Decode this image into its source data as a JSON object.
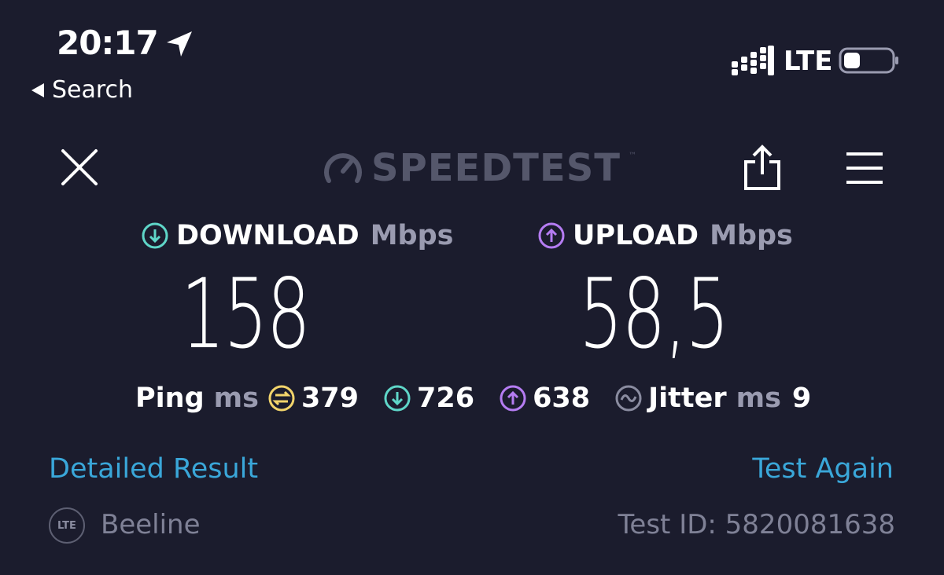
{
  "status_bar": {
    "time": "20:17",
    "back_label": "Search",
    "network": "LTE"
  },
  "header": {
    "logo_text": "SPEEDTEST",
    "logo_mark": "™"
  },
  "results": {
    "download": {
      "label": "DOWNLOAD",
      "unit": "Mbps",
      "value": "158",
      "color": "#5fd6c8"
    },
    "upload": {
      "label": "UPLOAD",
      "unit": "Mbps",
      "value": "58,5",
      "color": "#b57cf2"
    }
  },
  "ping": {
    "label": "Ping",
    "unit": "ms",
    "idle_value": "379",
    "download_value": "726",
    "upload_value": "638",
    "jitter_label": "Jitter",
    "jitter_unit": "ms",
    "jitter_value": "9",
    "idle_color": "#f2d46b"
  },
  "actions": {
    "detailed_label": "Detailed Result",
    "test_again_label": "Test Again"
  },
  "footer": {
    "badge": "LTE",
    "provider": "Beeline",
    "test_id": "Test ID: 5820081638"
  },
  "icons": [
    "location-arrow-icon",
    "back-triangle-icon",
    "signal-icon",
    "battery-icon",
    "close-icon",
    "speedtest-gauge-icon",
    "share-icon",
    "menu-icon",
    "download-arrow-icon",
    "upload-arrow-icon",
    "idle-ping-icon",
    "jitter-icon"
  ]
}
